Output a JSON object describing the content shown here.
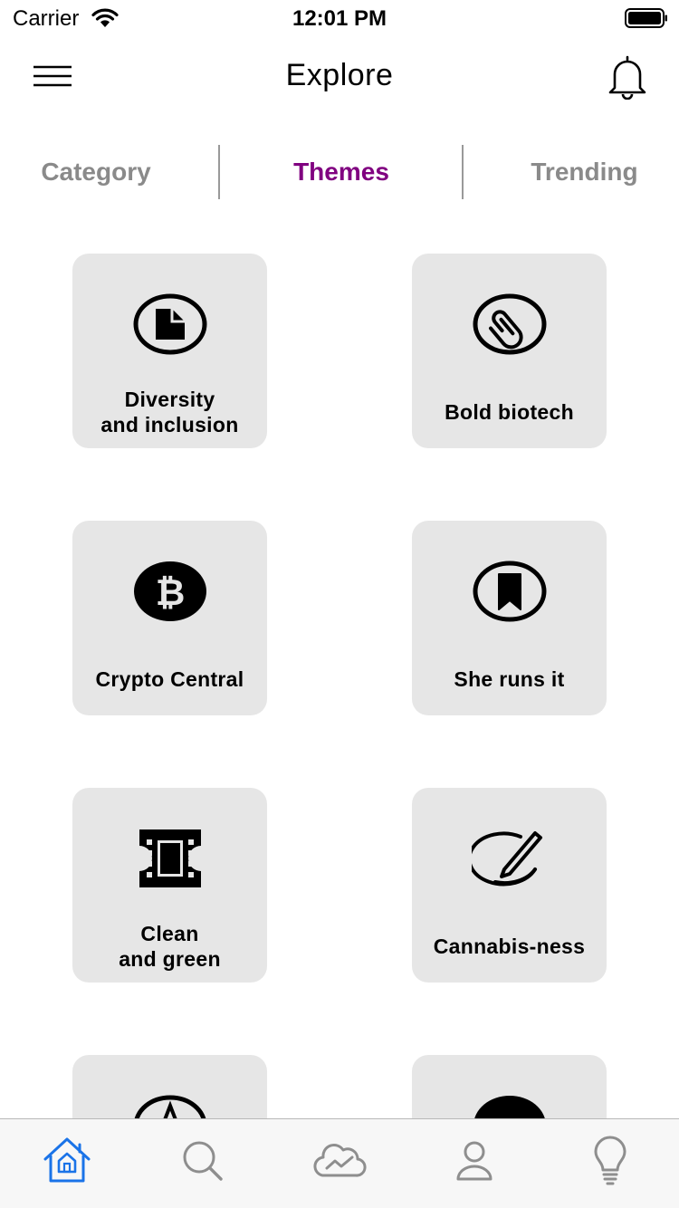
{
  "status_bar": {
    "carrier": "Carrier",
    "time": "12:01 PM",
    "icons": [
      "wifi-icon",
      "battery-icon"
    ]
  },
  "nav": {
    "title": "Explore",
    "left_icon": "hamburger-menu-icon",
    "right_icon": "bell-icon"
  },
  "tabs": [
    {
      "label": "Category",
      "active": false
    },
    {
      "label": "Themes",
      "active": true
    },
    {
      "label": "Trending",
      "active": false
    }
  ],
  "themes": [
    {
      "label": "Diversity\nand inclusion",
      "icon": "document-circle-icon"
    },
    {
      "label": "Bold biotech",
      "icon": "paperclip-circle-icon"
    },
    {
      "label": "Crypto Central",
      "icon": "bitcoin-circle-icon"
    },
    {
      "label": "She runs it",
      "icon": "bookmark-circle-icon"
    },
    {
      "label": "Clean\nand green",
      "icon": "film-icon"
    },
    {
      "label": "Cannabis-ness",
      "icon": "pencil-ellipse-icon"
    }
  ],
  "tab_bar": {
    "items": [
      {
        "name": "home",
        "icon": "home-icon",
        "active": true
      },
      {
        "name": "search",
        "icon": "search-icon",
        "active": false
      },
      {
        "name": "cloud-chart",
        "icon": "cloud-chart-icon",
        "active": false
      },
      {
        "name": "profile",
        "icon": "person-icon",
        "active": false
      },
      {
        "name": "ideas",
        "icon": "lightbulb-icon",
        "active": false
      }
    ]
  },
  "colors": {
    "accent": "#800080",
    "tab_inactive": "#8a8a8a",
    "card_bg": "#e6e6e6",
    "tab_bar_active": "#1a73e8",
    "tab_bar_inactive": "#8e8e8e"
  }
}
